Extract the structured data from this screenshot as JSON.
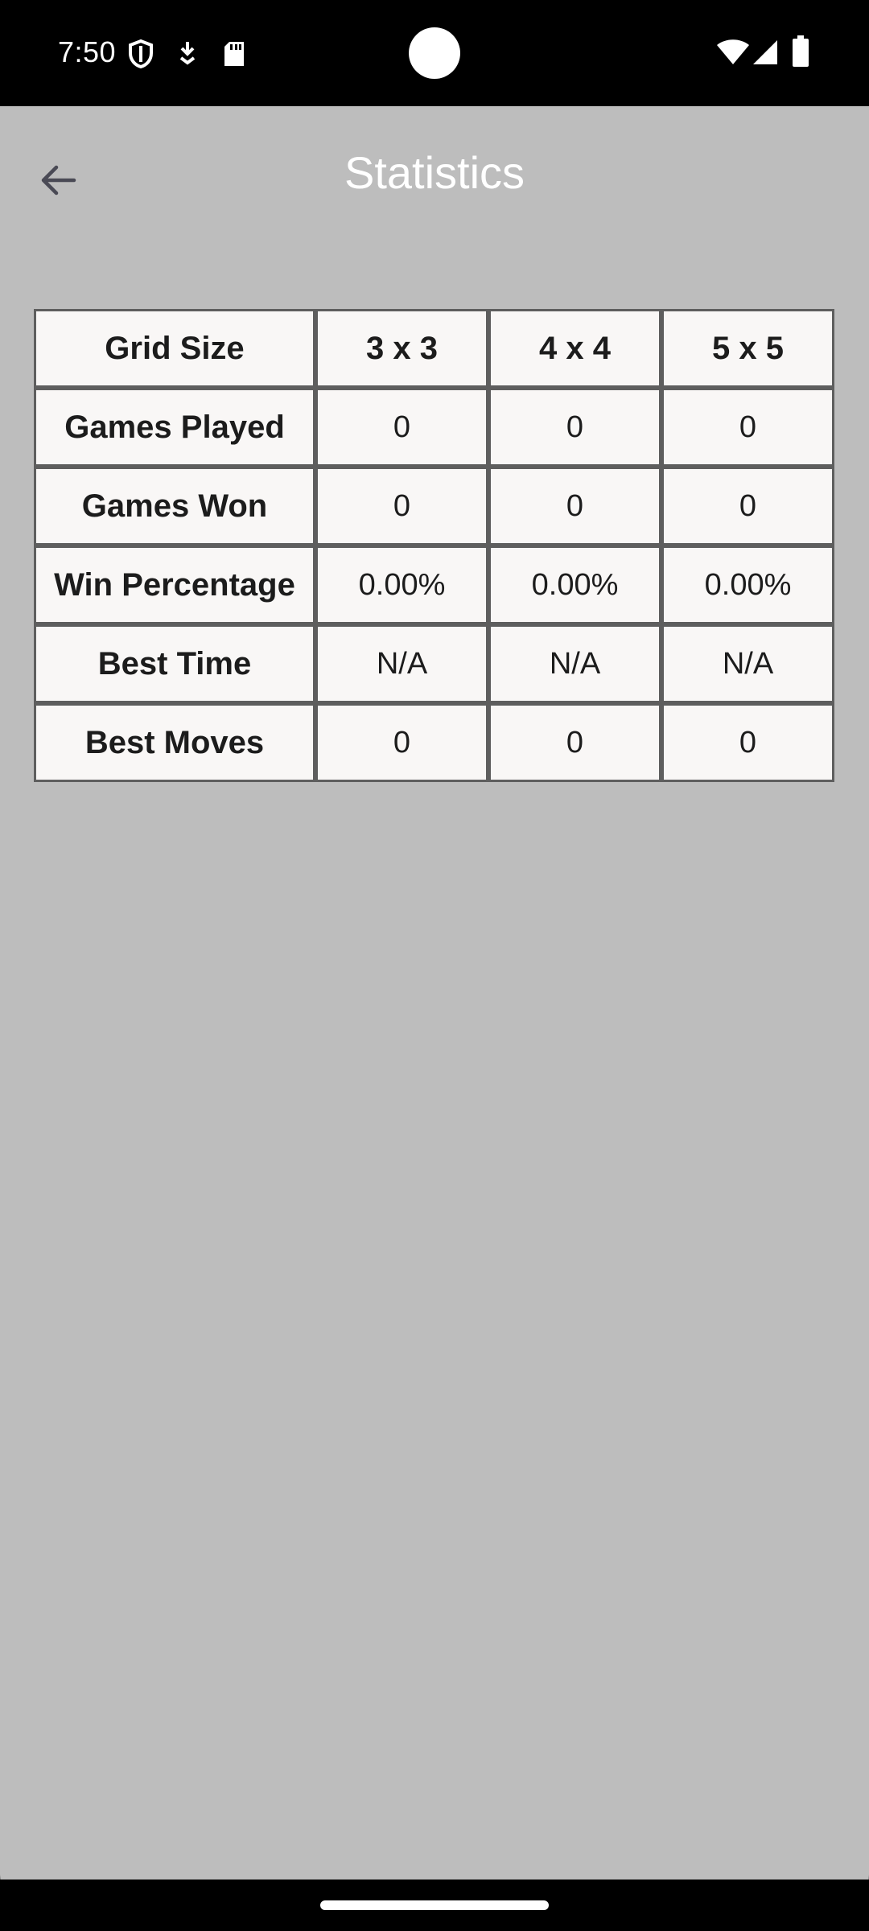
{
  "status_bar": {
    "time": "7:50",
    "icons": [
      "shield-icon",
      "download-icon",
      "sd-card-icon",
      "wifi-icon",
      "signal-icon",
      "battery-icon"
    ]
  },
  "toolbar": {
    "title": "Statistics",
    "back_icon": "arrow-back-icon"
  },
  "table": {
    "header": {
      "label": "Grid Size",
      "columns": [
        "3 x 3",
        "4 x 4",
        "5 x 5"
      ]
    },
    "rows": [
      {
        "label": "Games Played",
        "values": [
          "0",
          "0",
          "0"
        ]
      },
      {
        "label": "Games Won",
        "values": [
          "0",
          "0",
          "0"
        ]
      },
      {
        "label": "Win Percentage",
        "values": [
          "0.00%",
          "0.00%",
          "0.00%"
        ]
      },
      {
        "label": "Best Time",
        "values": [
          "N/A",
          "N/A",
          "N/A"
        ]
      },
      {
        "label": "Best Moves",
        "values": [
          "0",
          "0",
          "0"
        ]
      }
    ]
  },
  "colors": {
    "app_background": "#bdbdbd",
    "cell_background": "#f9f7f6",
    "cell_border": "#5e5e5e",
    "title_text": "#ffffff"
  }
}
